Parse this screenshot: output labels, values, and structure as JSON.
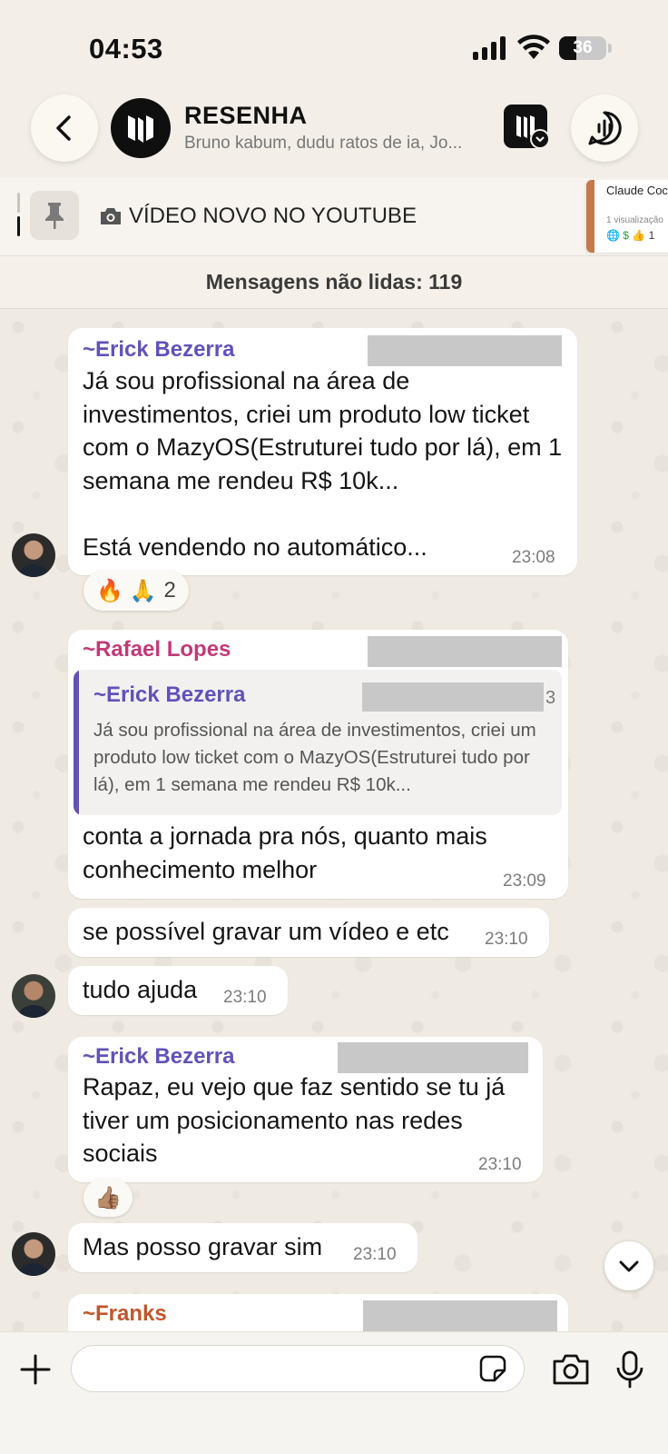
{
  "status_bar": {
    "time": "04:53",
    "battery": "36",
    "battery_level": 0.36
  },
  "header": {
    "group_name": "RESENHA",
    "members": "Bruno kabum, dudu ratos de ia, Jo..."
  },
  "pinned": {
    "text": "VÍDEO NOVO NO YOUTUBE",
    "card_title": "Claude Coc Completo e",
    "card_views": "1 visualização",
    "card_likes": "1"
  },
  "unread_banner": "Mensagens não lidas: 119",
  "messages": [
    {
      "sender": "~Erick Bezerra",
      "sender_color": "#6251b9",
      "text": "Já sou profissional na área de investimentos, criei um produto low ticket com o MazyOS(Estruturei tudo por lá), em 1 semana me rendeu R$ 10k...\n\nEstá vendendo no automático...",
      "time": "23:08",
      "reactions": "🔥 🙏",
      "reaction_count": "2"
    },
    {
      "sender": "~Rafael Lopes",
      "sender_color": "#c13a78",
      "quote_sender": "~Erick Bezerra",
      "quote_suffix": "3",
      "quote_text": "Já sou profissional na área de investimentos, criei um produto low ticket com o MazyOS(Estruturei tudo por lá), em 1 semana me rendeu R$ 10k...",
      "text": "conta a jornada pra nós, quanto mais conhecimento melhor",
      "time": "23:09"
    },
    {
      "text": "se possível gravar um vídeo e etc",
      "time": "23:10"
    },
    {
      "text": "tudo ajuda",
      "time": "23:10"
    },
    {
      "sender": "~Erick Bezerra",
      "sender_color": "#6251b9",
      "text": "Rapaz, eu vejo que faz sentido se tu já tiver um posicionamento nas redes sociais",
      "time": "23:10",
      "reactions": "👍🏽"
    },
    {
      "text": "Mas posso gravar sim",
      "time": "23:10"
    },
    {
      "sender": "~Franks",
      "sender_color": "#c2552b"
    }
  ],
  "input": {
    "placeholder": ""
  }
}
